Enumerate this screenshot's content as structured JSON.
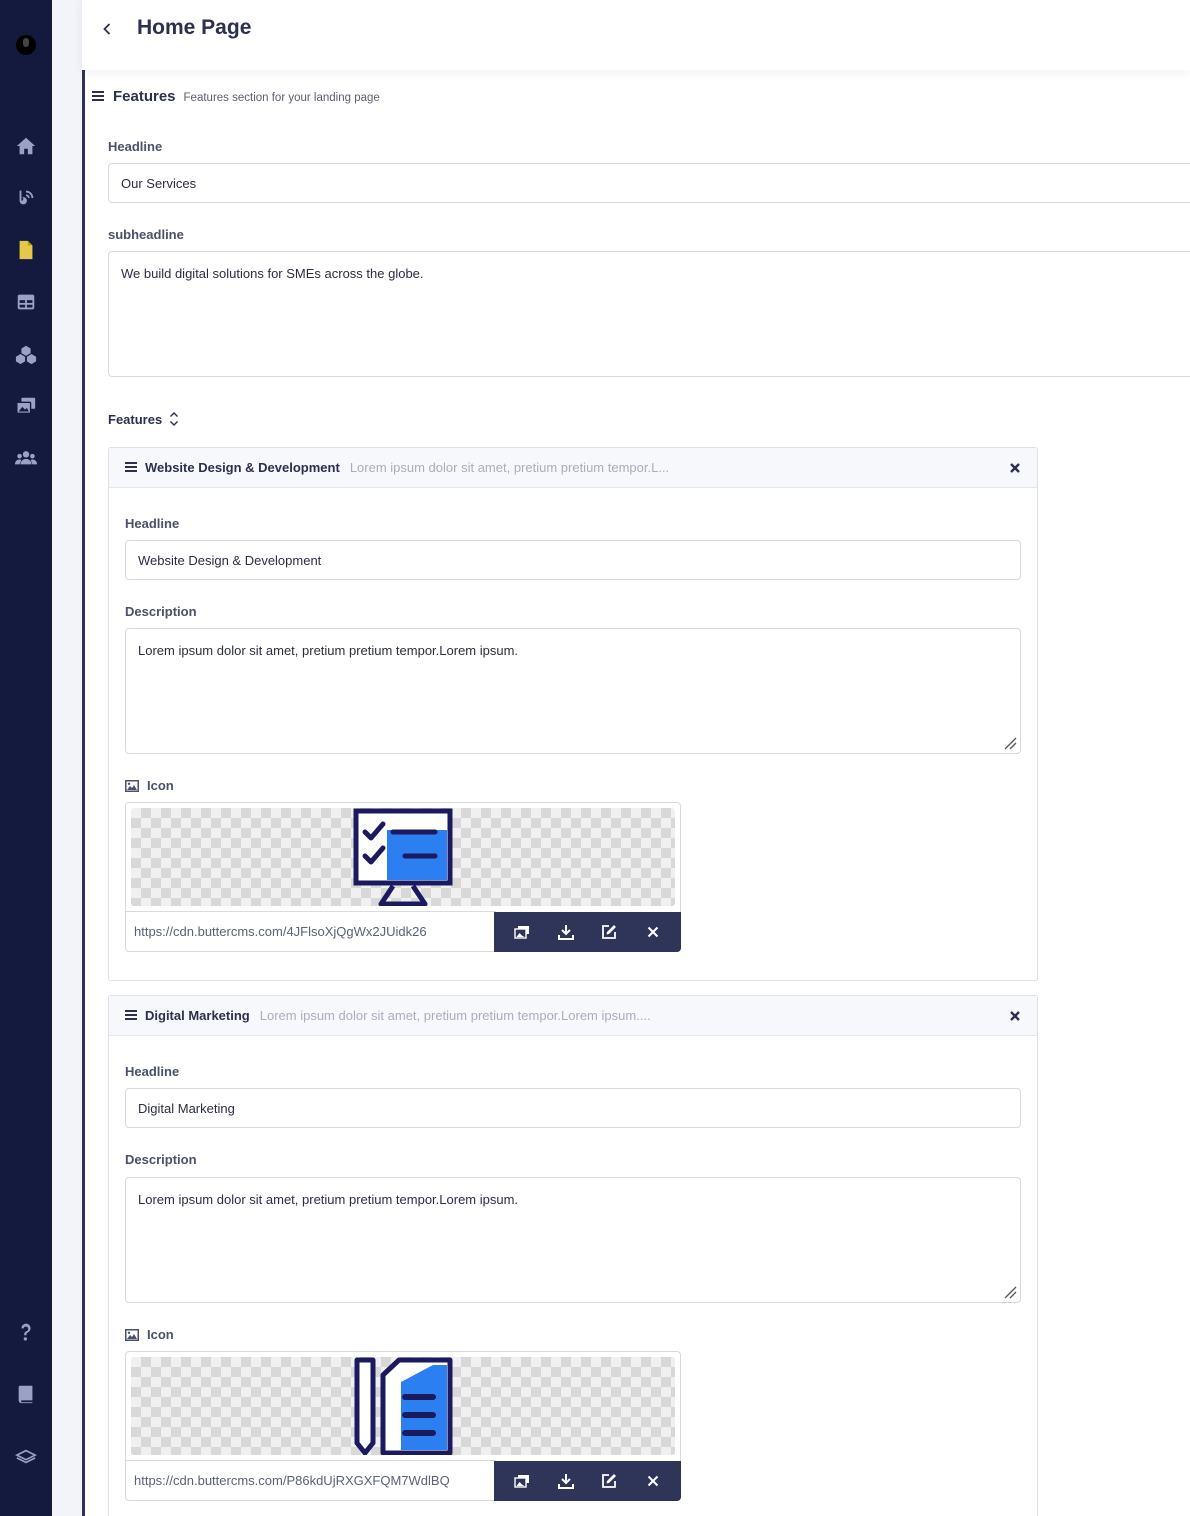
{
  "header": {
    "title": "Home Page"
  },
  "sidebar": {
    "items": [
      {
        "icon": "home-icon"
      },
      {
        "icon": "blog-icon"
      },
      {
        "icon": "pages-icon",
        "color": "#e3c84a"
      },
      {
        "icon": "collections-icon"
      },
      {
        "icon": "components-icon"
      },
      {
        "icon": "media-icon"
      },
      {
        "icon": "users-icon"
      }
    ],
    "bottom": [
      {
        "icon": "help-icon"
      },
      {
        "icon": "docs-icon"
      },
      {
        "icon": "layers-icon"
      }
    ]
  },
  "section": {
    "title": "Features",
    "description": "Features section for your landing page",
    "headline_label": "Headline",
    "headline_value": "Our Services",
    "subheadline_label": "subheadline",
    "subheadline_value": "We build digital solutions for SMEs across the globe.",
    "features_label": "Features"
  },
  "features": [
    {
      "title": "Website Design & Development",
      "summary": "Lorem ipsum dolor sit amet, pretium pretium tempor.L...",
      "headline_label": "Headline",
      "headline_value": "Website Design & Development",
      "description_label": "Description",
      "description_value": "Lorem ipsum dolor sit amet, pretium pretium tempor.Lorem ipsum.",
      "icon_label": "Icon",
      "icon_url": "https://cdn.buttercms.com/4JFlsoXjQgWx2JUidk26"
    },
    {
      "title": "Digital Marketing",
      "summary": "Lorem ipsum dolor sit amet, pretium pretium tempor.Lorem ipsum....",
      "headline_label": "Headline",
      "headline_value": "Digital Marketing",
      "description_label": "Description",
      "description_value": "Lorem ipsum dolor sit amet, pretium pretium tempor.Lorem ipsum.",
      "icon_label": "Icon",
      "icon_url": "https://cdn.buttercms.com/P86kdUjRXGXFQM7WdlBQ"
    }
  ],
  "colors": {
    "sidebar": "#141a3d",
    "accent_blue": "#2b7ff0",
    "icon_navy": "#1c1a5e"
  }
}
